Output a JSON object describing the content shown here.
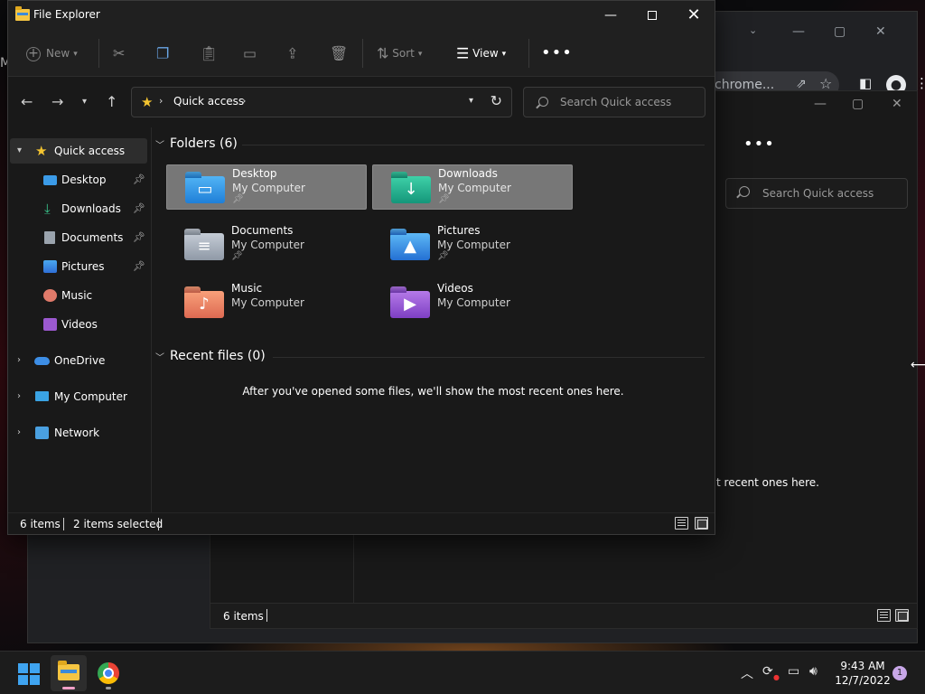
{
  "background": {
    "chrome": {
      "omnibox_fragment": "chrome..."
    },
    "explorer": {
      "search_placeholder": "Search Quick access",
      "recent_fragment": "t recent ones here.",
      "status": "6 items"
    },
    "left_stub": "M"
  },
  "window": {
    "title": "File Explorer",
    "minimize": "—",
    "close": "✕"
  },
  "toolbar": {
    "new_label": "New",
    "sort_label": "Sort",
    "view_label": "View",
    "more_label": "•••"
  },
  "address": {
    "location": "Quick access",
    "search_placeholder": "Search Quick access"
  },
  "nav_pane": {
    "quick_access": "Quick access",
    "items": [
      {
        "label": "Desktop"
      },
      {
        "label": "Downloads"
      },
      {
        "label": "Documents"
      },
      {
        "label": "Pictures"
      },
      {
        "label": "Music"
      },
      {
        "label": "Videos"
      }
    ],
    "onedrive": "OneDrive",
    "my_computer": "My Computer",
    "network": "Network"
  },
  "content": {
    "folders_header": "Folders (6)",
    "folders": [
      {
        "name": "Desktop",
        "location": "My Computer",
        "pinned": true,
        "selected": true
      },
      {
        "name": "Downloads",
        "location": "My Computer",
        "pinned": true,
        "selected": true
      },
      {
        "name": "Documents",
        "location": "My Computer",
        "pinned": true,
        "selected": false
      },
      {
        "name": "Pictures",
        "location": "My Computer",
        "pinned": true,
        "selected": false
      },
      {
        "name": "Music",
        "location": "My Computer",
        "pinned": false,
        "selected": false
      },
      {
        "name": "Videos",
        "location": "My Computer",
        "pinned": false,
        "selected": false
      }
    ],
    "recent_header": "Recent files (0)",
    "empty_message": "After you've opened some files, we'll show the most recent ones here."
  },
  "status": {
    "item_count": "6 items",
    "selection": "2 items selected"
  },
  "taskbar": {
    "time": "9:43 AM",
    "date": "12/7/2022",
    "notifications": "1"
  }
}
